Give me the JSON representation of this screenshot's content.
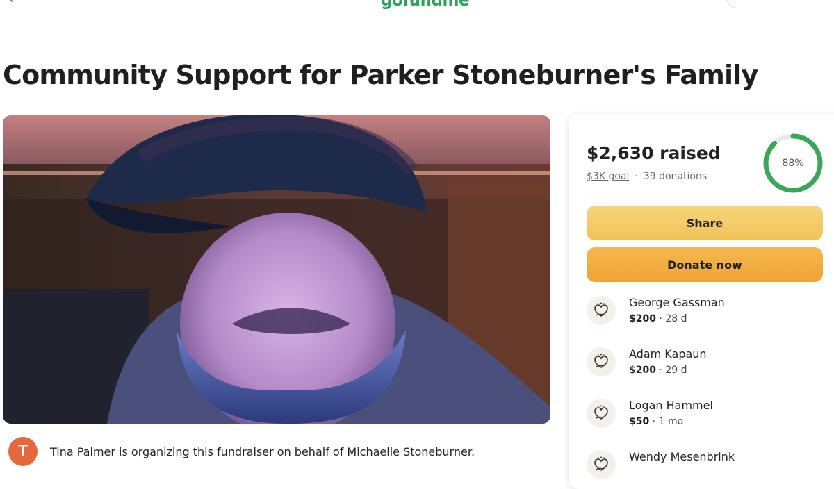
{
  "header": {
    "logo_text": "gofundme",
    "back_glyph": "‹",
    "right_glyph": "·"
  },
  "campaign": {
    "title": "Community Support for Parker Stoneburner's Family",
    "hero_image_alt": "photo"
  },
  "organizer": {
    "avatar_letter": "T",
    "text": "Tina Palmer is organizing this fundraiser on behalf of Michaelle Stoneburner."
  },
  "progress": {
    "raised": "$2,630 raised",
    "goal": "$3K goal",
    "separator": "·",
    "donations": "39 donations",
    "percent_label": "88%",
    "percent_value": 0.88
  },
  "buttons": {
    "share": "Share",
    "donate": "Donate now"
  },
  "donors": [
    {
      "name": "George Gassman",
      "amount": "$200",
      "when": " · 28 d"
    },
    {
      "name": "Adam Kapaun",
      "amount": "$200",
      "when": " · 29 d"
    },
    {
      "name": "Logan Hammel",
      "amount": "$50",
      "when": " · 1 mo"
    },
    {
      "name": "Wendy Mesenbrink",
      "amount": "",
      "when": ""
    }
  ],
  "colors": {
    "brand_green": "#2ea25a",
    "ring_green": "#3aa757",
    "share_yellow": "#f3c963",
    "donate_orange": "#f0aa40",
    "avatar_orange": "#e4683b"
  },
  "icons": {
    "donor_icon": "heart-hand-icon"
  }
}
